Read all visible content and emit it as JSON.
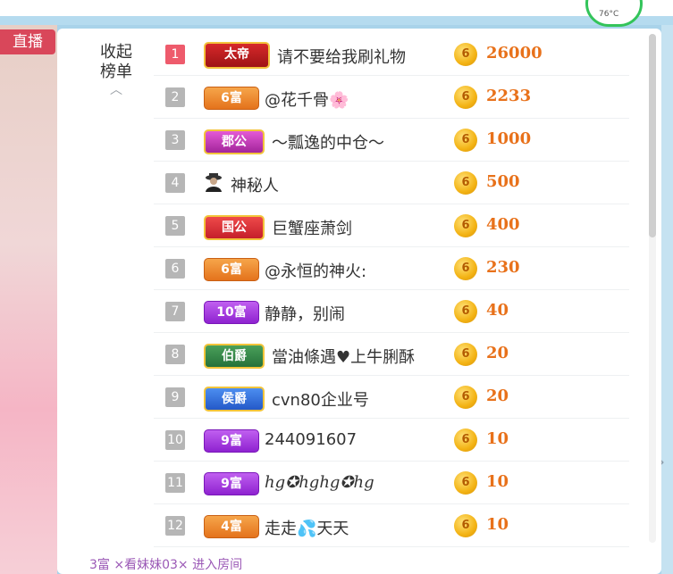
{
  "live_badge": "直播",
  "weather": {
    "temp": "76°C"
  },
  "collapse": {
    "line1": "收起",
    "line2": "榜单"
  },
  "colors": {
    "accent": "#ee5b6c",
    "amount": "#e8711a"
  },
  "rows": [
    {
      "rank": "1",
      "badge": "太帝",
      "badge_style": "emperor",
      "name": "请不要给我刷礼物",
      "coin": "6",
      "amount": "26000"
    },
    {
      "rank": "2",
      "badge": "6富",
      "badge_style": "orange",
      "name": "@花千骨🌸",
      "coin": "6",
      "amount": "2233"
    },
    {
      "rank": "3",
      "badge": "郡公",
      "badge_style": "pink",
      "name": "～瓢逸的中仓～",
      "coin": "6",
      "amount": "1000"
    },
    {
      "rank": "4",
      "badge": "",
      "badge_style": "mystery",
      "name": "神秘人",
      "coin": "6",
      "amount": "500"
    },
    {
      "rank": "5",
      "badge": "国公",
      "badge_style": "red",
      "name": "巨蟹座萧剑",
      "coin": "6",
      "amount": "400"
    },
    {
      "rank": "6",
      "badge": "6富",
      "badge_style": "orange",
      "name": "@永恒的神火:",
      "coin": "6",
      "amount": "230"
    },
    {
      "rank": "7",
      "badge": "10富",
      "badge_style": "purple",
      "name": "静静，别闹",
      "coin": "6",
      "amount": "40"
    },
    {
      "rank": "8",
      "badge": "伯爵",
      "badge_style": "green",
      "name": "當油條遇♥上牛脷酥",
      "coin": "6",
      "amount": "20"
    },
    {
      "rank": "9",
      "badge": "侯爵",
      "badge_style": "blue",
      "name": "cvn80企业号",
      "coin": "6",
      "amount": "20"
    },
    {
      "rank": "10",
      "badge": "9富",
      "badge_style": "purple",
      "name": "244091607",
      "coin": "6",
      "amount": "10"
    },
    {
      "rank": "11",
      "badge": "9富",
      "badge_style": "purple",
      "name": "ℎ𝑔✪ℎ𝑔ℎ𝑔✪ℎ𝑔",
      "coin": "6",
      "amount": "10"
    },
    {
      "rank": "12",
      "badge": "4富",
      "badge_style": "orange",
      "name": "走走💦天天",
      "coin": "6",
      "amount": "10"
    }
  ],
  "footer_text": "3富  ×看妹妹03×  进入房间"
}
